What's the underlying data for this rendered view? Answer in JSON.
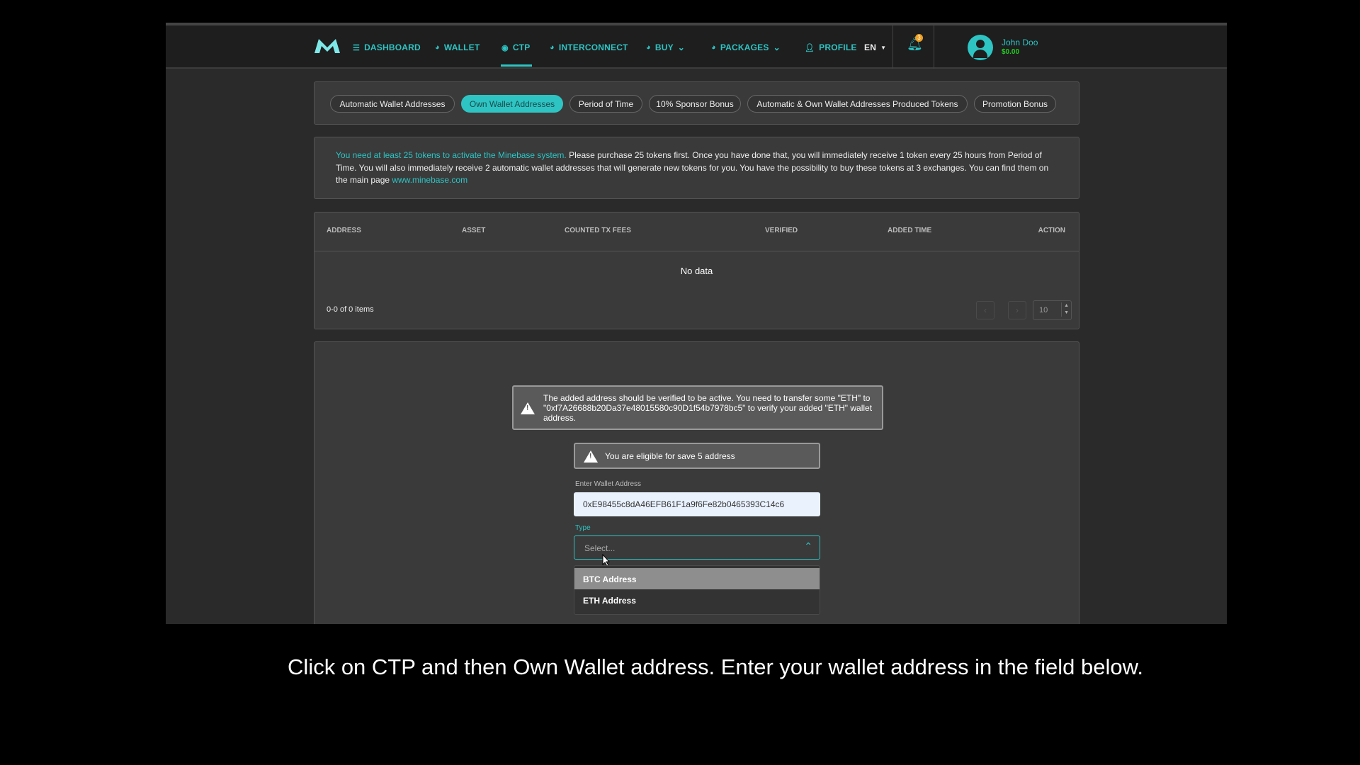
{
  "nav": {
    "items": [
      {
        "label": "DASHBOARD",
        "icon": "list-icon"
      },
      {
        "label": "WALLET",
        "icon": "pie-icon"
      },
      {
        "label": "CTP",
        "icon": "ctp-icon"
      },
      {
        "label": "INTERCONNECT",
        "icon": "pie-icon"
      },
      {
        "label": "BUY",
        "icon": "pie-icon"
      },
      {
        "label": "PACKAGES",
        "icon": "pie-icon"
      },
      {
        "label": "PROFILE",
        "icon": "user-icon"
      }
    ],
    "language": "EN",
    "notifications": "3",
    "user_name": "John Doo",
    "balance": "$0.00",
    "active": "CTP"
  },
  "tabs": [
    "Automatic Wallet Addresses",
    "Own Wallet Addresses",
    "Period of Time",
    "10% Sponsor Bonus",
    "Automatic & Own Wallet Addresses Produced Tokens",
    "Promotion Bonus"
  ],
  "active_tab": "Own Wallet Addresses",
  "info": {
    "highlight": "You need at least 25 tokens to activate the Minebase system.",
    "text": " Please purchase 25 tokens first. Once you have done that, you will immediately receive 1 token every 25 hours from Period of Time. You will also immediately receive 2 automatic wallet addresses that will generate new tokens for you. You have the possibility to buy these tokens at 3 exchanges. You can find them on the main page ",
    "link": "www.minebase.com"
  },
  "table": {
    "columns": [
      "ADDRESS",
      "ASSET",
      "COUNTED TX FEES",
      "VERIFIED",
      "ADDED TIME",
      "ACTION"
    ],
    "empty": "No data",
    "summary": "0-0 of 0 items",
    "page_size": "10"
  },
  "form": {
    "verify_warning": "The added address should be verified to be active. You need to transfer some \"ETH\" to \"0xf7A26688b20Da37e48015580c90D1f54b7978bc5\" to verify your added \"ETH\" wallet address.",
    "eligible": "You are eligible for save 5 address",
    "address_label": "Enter Wallet Address",
    "address_value": "0xE98455c8dA46EFB61F1a9f6Fe82b0465393C14c6",
    "type_label": "Type",
    "type_placeholder": "Select...",
    "type_options": [
      "BTC Address",
      "ETH Address"
    ]
  },
  "caption": "Click on CTP and then Own Wallet address. Enter your wallet address in the field below.",
  "colors": {
    "accent": "#2ec4c4",
    "balance": "#22cc22",
    "badge": "#f0a020"
  }
}
